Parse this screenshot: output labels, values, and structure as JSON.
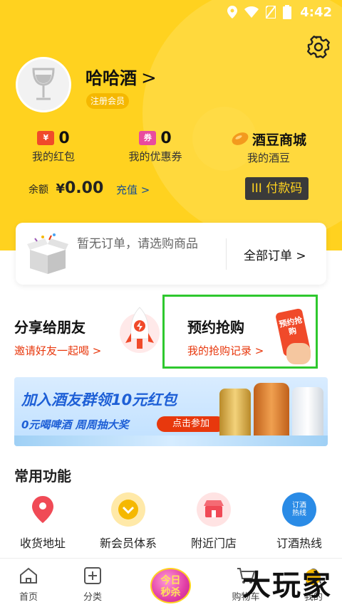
{
  "status": {
    "time": "4:42"
  },
  "profile": {
    "name": "哈哈酒",
    "name_chevron": ">",
    "member_badge": "注册会员"
  },
  "stats": {
    "red_packet": {
      "icon": "¥",
      "count": "0",
      "label": "我的红包"
    },
    "coupon": {
      "icon": "券",
      "count": "0",
      "label": "我的优惠券"
    },
    "bean": {
      "title": "酒豆商城",
      "label": "我的酒豆"
    }
  },
  "wallet": {
    "balance_label": "余额",
    "currency": "¥",
    "amount": "0.00",
    "recharge": "充值 >",
    "paycode": "III 付款码"
  },
  "orders": {
    "empty_text": "暂无订单，请选购商品",
    "all_orders": "全部订单 >"
  },
  "promos": {
    "share": {
      "title": "分享给朋友",
      "sub": "邀请好友一起喝 >"
    },
    "reserve": {
      "title": "预约抢购",
      "sub": "我的抢购记录 >",
      "phone_text": "预约抢购"
    }
  },
  "banner": {
    "line1": "加入酒友群领10元红包",
    "line2": "0元喝啤酒 周周抽大奖",
    "cta": "点击参加"
  },
  "common": {
    "title": "常用功能",
    "items": [
      {
        "label": "收货地址",
        "icon": "location-pin-icon"
      },
      {
        "label": "新会员体系",
        "icon": "chevron-badge-icon"
      },
      {
        "label": "附近门店",
        "icon": "store-icon"
      },
      {
        "label": "订酒热线",
        "icon": "hotline-icon",
        "icon_text": "订酒\n热线"
      }
    ]
  },
  "tabbar": {
    "home": "首页",
    "category": "分类",
    "today": "今日\n秒杀",
    "cart": "购物车",
    "mine": "我的"
  },
  "watermark": "大玩家",
  "colors": {
    "brand_yellow": "#FFD21F",
    "accent_red": "#E8380D",
    "highlight_green": "#2ec82e"
  }
}
